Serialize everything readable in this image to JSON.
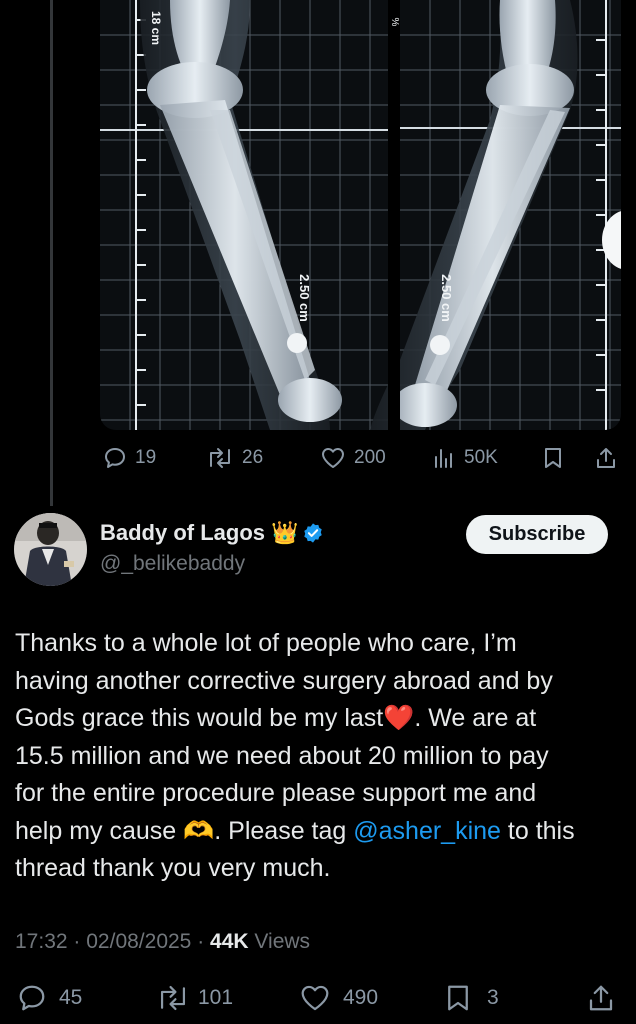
{
  "media": {
    "ruler_label_top": "18 cm",
    "percent_mark": "%",
    "marker_left": "2.50 cm",
    "marker_right": "2.50 cm"
  },
  "parent_actions": {
    "replies": "19",
    "reposts": "26",
    "likes": "200",
    "views": "50K"
  },
  "author": {
    "display_name": "Baddy of Lagos",
    "crown_emoji": "👑",
    "handle": "@_belikebaddy",
    "verified_color": "#1d9bf0"
  },
  "subscribe_label": "Subscribe",
  "tweet": {
    "line1": "Thanks to a whole lot of people who care, I’m",
    "line2": "having another corrective surgery abroad and by",
    "line3_a": "Gods grace this would be my last",
    "heart_emoji": "❤️",
    "line3_b": ". We are at",
    "line4": "15.5 million and we need about 20 million to pay",
    "line5": "for the entire procedure please support me and",
    "line6_a": "help my cause ",
    "hands_emoji": "🫶",
    "line6_b": ". Please tag ",
    "mention": "@asher_kine",
    "line6_c": " to this",
    "line7": "thread thank you very much."
  },
  "meta": {
    "time": "17:32",
    "date": "02/08/2025",
    "views_count": "44K",
    "views_label": "Views",
    "sep": "·"
  },
  "actions": {
    "replies": "45",
    "reposts": "101",
    "likes": "490",
    "bookmarks": "3"
  },
  "colors": {
    "background": "#000000",
    "text": "#e7e9ea",
    "muted": "#71767b",
    "icon": "#8b98a5",
    "link": "#1d9bf0"
  }
}
